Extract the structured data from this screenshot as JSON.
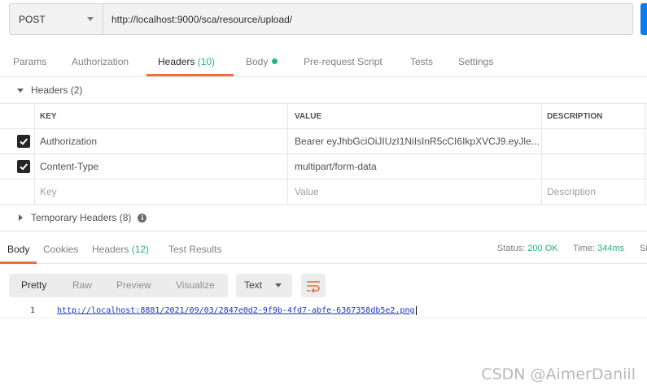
{
  "request": {
    "method": "POST",
    "url": "http://localhost:9000/sca/resource/upload/"
  },
  "request_tabs": {
    "params": "Params",
    "authorization": "Authorization",
    "headers": "Headers",
    "headers_count": "(10)",
    "body": "Body",
    "prerequest": "Pre-request Script",
    "tests": "Tests",
    "settings": "Settings"
  },
  "headers_section": {
    "title": "Headers",
    "count": "(2)",
    "columns": {
      "key": "KEY",
      "value": "VALUE",
      "description": "DESCRIPTION"
    },
    "rows": [
      {
        "key": "Authorization",
        "value": "Bearer eyJhbGciOiJIUzI1NiIsInR5cCI6IkpXVCJ9.eyJle...",
        "description": ""
      },
      {
        "key": "Content-Type",
        "value": "multipart/form-data",
        "description": ""
      }
    ],
    "placeholders": {
      "key": "Key",
      "value": "Value",
      "description": "Description"
    }
  },
  "temporary_headers": {
    "title": "Temporary Headers",
    "count": "(8)"
  },
  "response_tabs": {
    "body": "Body",
    "cookies": "Cookies",
    "headers": "Headers",
    "headers_count": "(12)",
    "test_results": "Test Results"
  },
  "response_status": {
    "status_label": "Status:",
    "status_value": "200 OK",
    "time_label": "Time:",
    "time_value": "344ms",
    "size_label_partial": "Si"
  },
  "body_toolbar": {
    "pretty": "Pretty",
    "raw": "Raw",
    "preview": "Preview",
    "visualize": "Visualize",
    "format": "Text"
  },
  "response_body": {
    "line_number": "1",
    "content": "http://localhost:8881/2021/09/03/2847e0d2-9f9b-4fd7-abfe-6367358db5e2.png"
  },
  "watermark": "CSDN @AimerDaniil",
  "colors": {
    "accent": "#f26b3a",
    "success": "#26b47f",
    "link": "#1c32c4",
    "send": "#097bed"
  }
}
